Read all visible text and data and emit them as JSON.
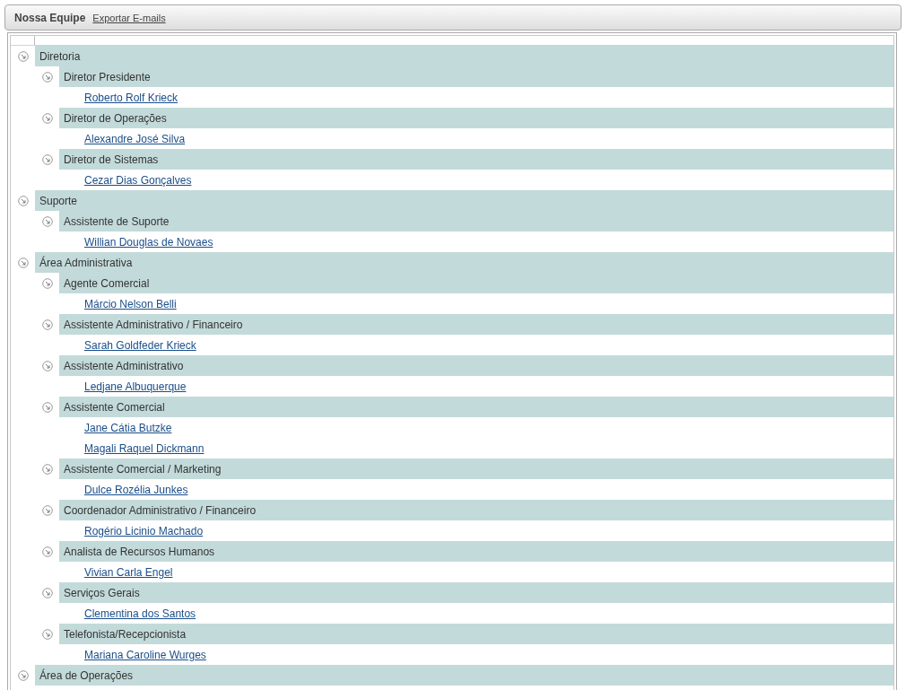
{
  "header": {
    "title": "Nossa Equipe",
    "export_link": "Exportar E-mails"
  },
  "departments": [
    {
      "name": "Diretoria",
      "expanded": true,
      "roles": [
        {
          "name": "Diretor Presidente",
          "expanded": true,
          "people": [
            "Roberto Rolf Krieck"
          ]
        },
        {
          "name": "Diretor de Operações",
          "expanded": true,
          "people": [
            "Alexandre José Silva"
          ]
        },
        {
          "name": "Diretor de Sistemas",
          "expanded": true,
          "people": [
            "Cezar Dias Gonçalves"
          ]
        }
      ]
    },
    {
      "name": "Suporte",
      "expanded": true,
      "roles": [
        {
          "name": "Assistente de Suporte",
          "expanded": true,
          "people": [
            "Willian Douglas de Novaes"
          ]
        }
      ]
    },
    {
      "name": "Área Administrativa",
      "expanded": true,
      "roles": [
        {
          "name": "Agente Comercial",
          "expanded": true,
          "people": [
            "Márcio Nelson Belli"
          ]
        },
        {
          "name": "Assistente Administrativo / Financeiro",
          "expanded": true,
          "people": [
            "Sarah Goldfeder Krieck"
          ]
        },
        {
          "name": "Assistente Administrativo",
          "expanded": true,
          "people": [
            "Ledjane Albuquerque"
          ]
        },
        {
          "name": "Assistente Comercial",
          "expanded": true,
          "people": [
            "Jane Cátia Butzke",
            "Magali Raquel Dickmann"
          ]
        },
        {
          "name": "Assistente Comercial / Marketing",
          "expanded": true,
          "people": [
            "Dulce Rozélia Junkes"
          ]
        },
        {
          "name": "Coordenador Administrativo / Financeiro",
          "expanded": true,
          "people": [
            "Rogério Licinio Machado"
          ]
        },
        {
          "name": "Analista de Recursos Humanos",
          "expanded": true,
          "people": [
            "Vivian Carla Engel"
          ]
        },
        {
          "name": "Serviços Gerais",
          "expanded": true,
          "people": [
            "Clementina dos Santos"
          ]
        },
        {
          "name": "Telefonista/Recepcionista",
          "expanded": true,
          "people": [
            "Mariana Caroline Wurges"
          ]
        }
      ]
    },
    {
      "name": "Área de Operações",
      "expanded": true
    }
  ]
}
